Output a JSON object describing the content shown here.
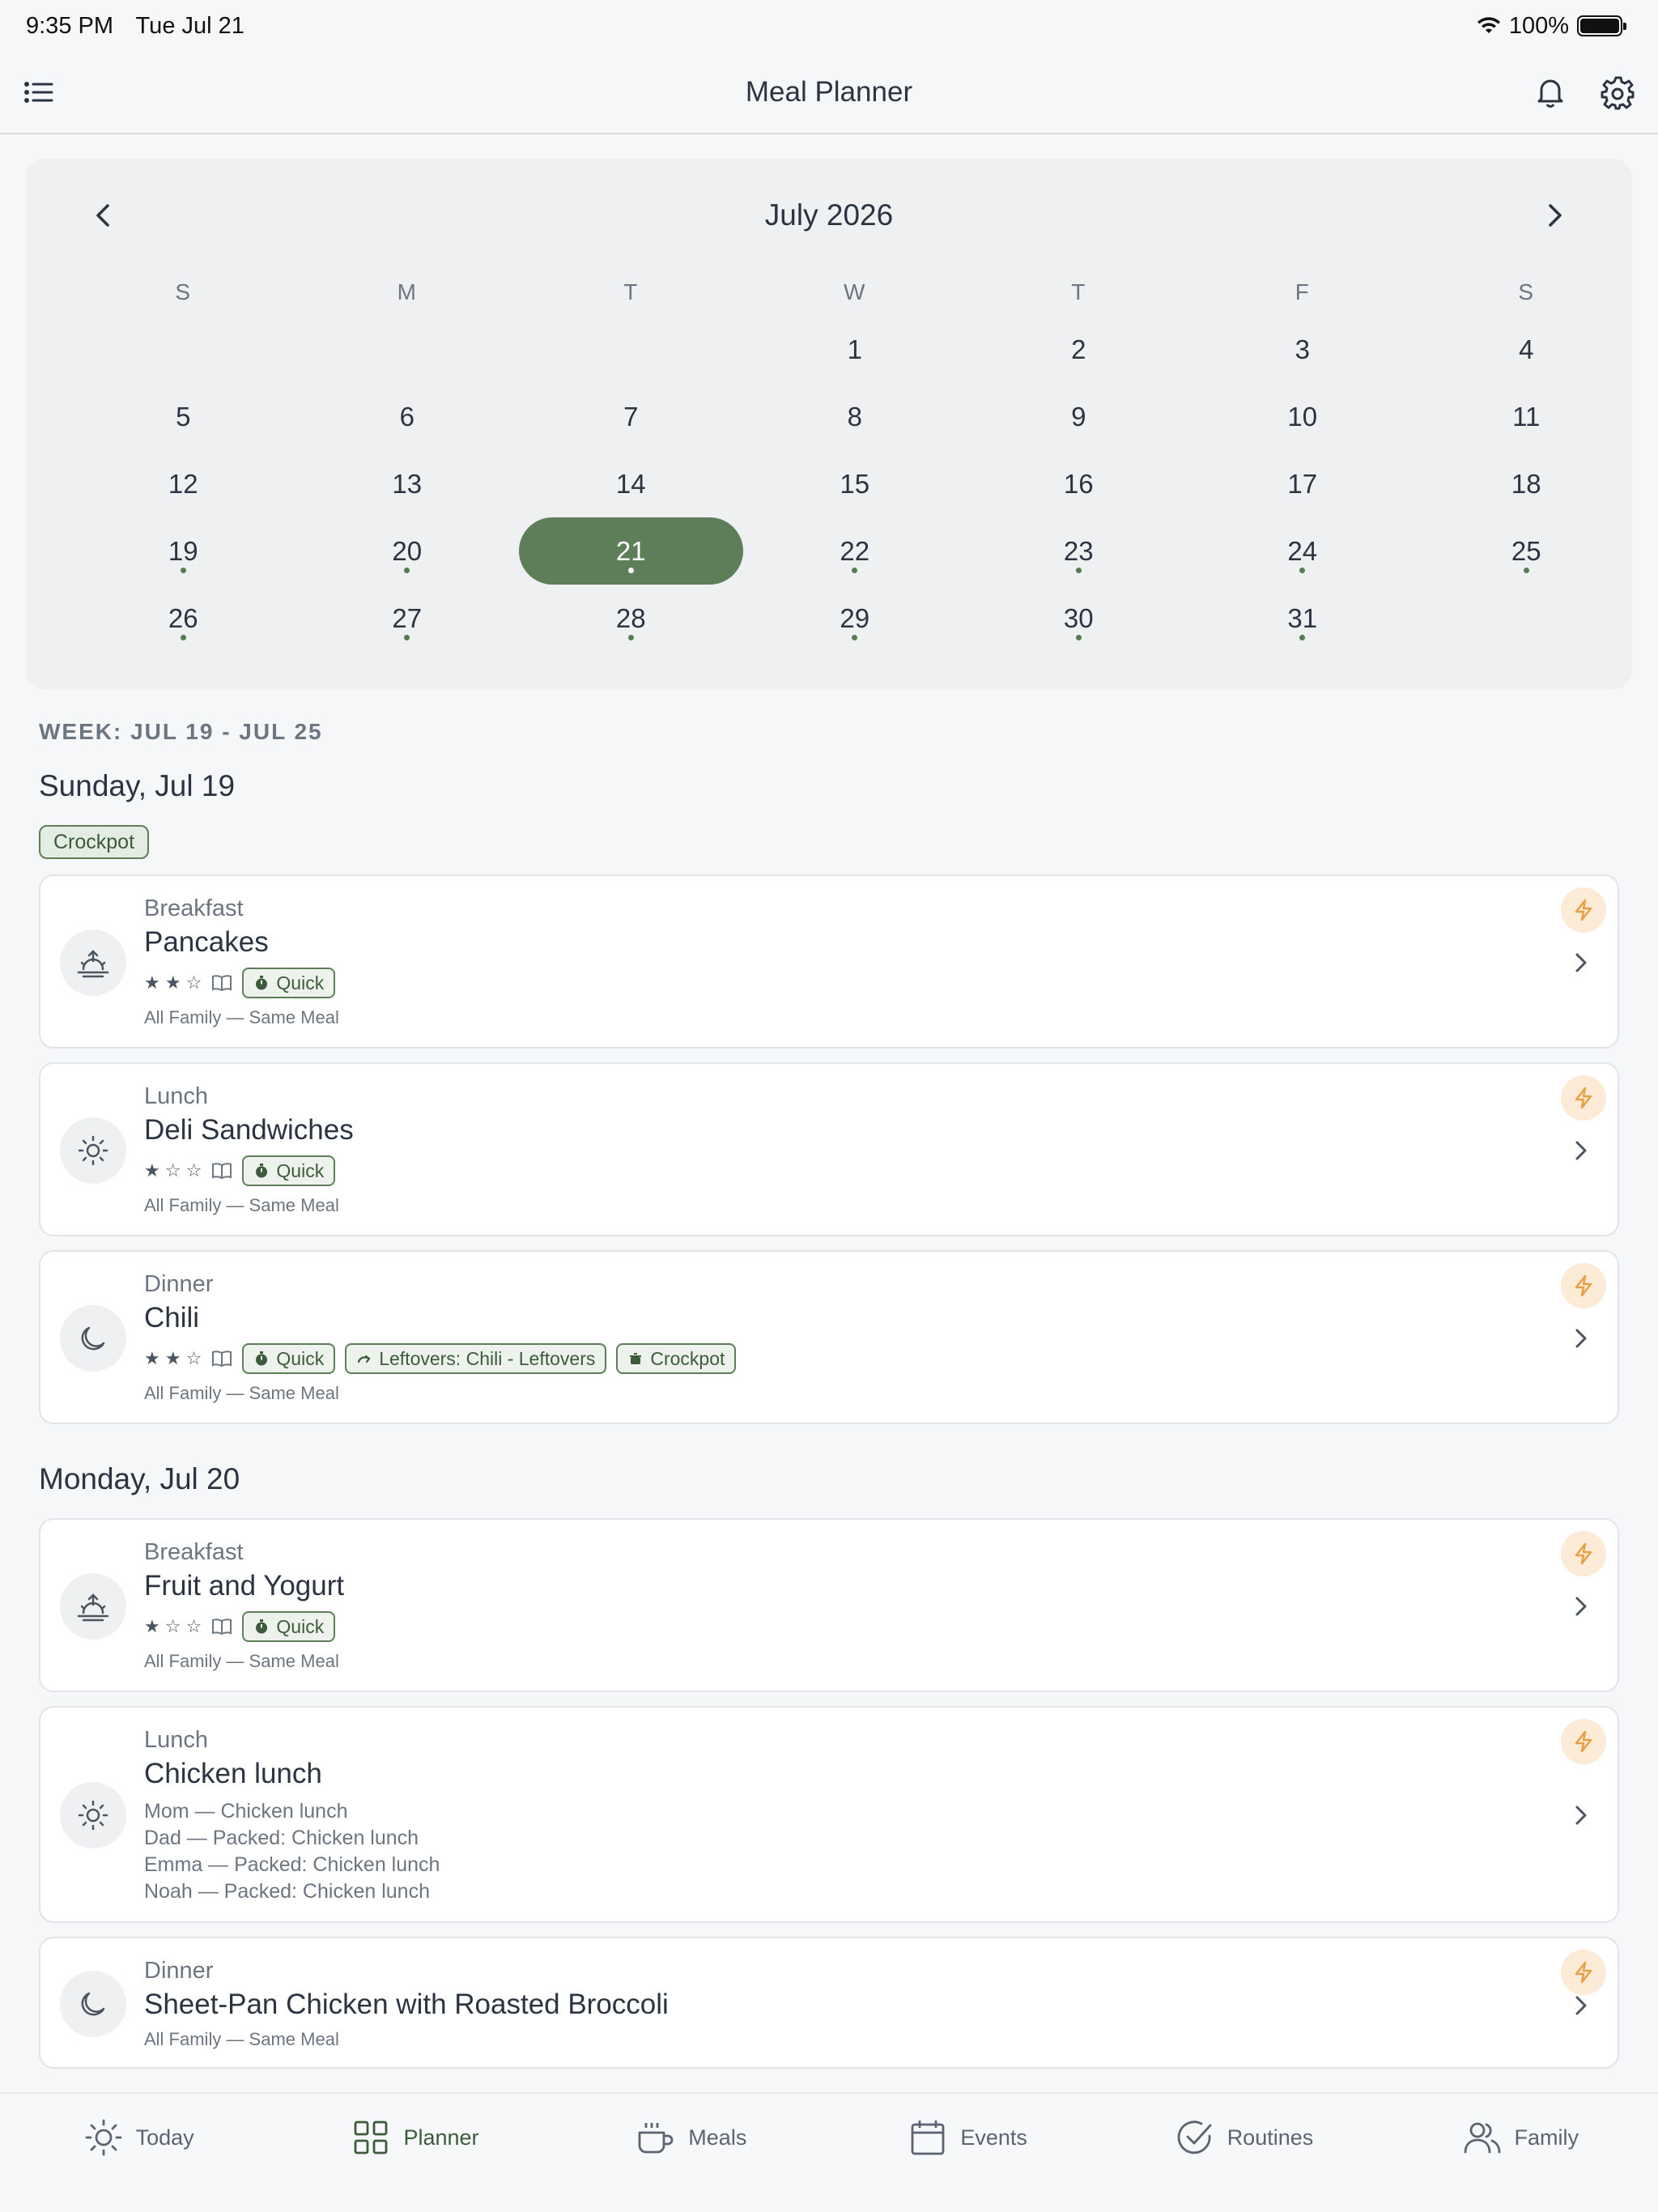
{
  "status_bar": {
    "time": "9:35 PM",
    "date": "Tue Jul 21",
    "battery": "100%"
  },
  "header": {
    "title": "Meal Planner"
  },
  "calendar": {
    "month_label": "July 2026",
    "weekdays": [
      "S",
      "M",
      "T",
      "W",
      "T",
      "F",
      "S"
    ],
    "weeks": [
      [
        "",
        "",
        "",
        "1",
        "2",
        "3",
        "4"
      ],
      [
        "5",
        "6",
        "7",
        "8",
        "9",
        "10",
        "11"
      ],
      [
        "12",
        "13",
        "14",
        "15",
        "16",
        "17",
        "18"
      ],
      [
        "19",
        "20",
        "21",
        "22",
        "23",
        "24",
        "25"
      ],
      [
        "26",
        "27",
        "28",
        "29",
        "30",
        "31",
        ""
      ]
    ],
    "selected_day": "21",
    "days_with_meals": [
      "19",
      "20",
      "21",
      "22",
      "23",
      "24",
      "25",
      "26",
      "27",
      "28",
      "29",
      "30",
      "31"
    ]
  },
  "week_label": "WEEK: JUL 19 - JUL 25",
  "days": [
    {
      "heading": "Sunday, Jul 19",
      "tag": "Crockpot",
      "meals": [
        {
          "type": "Breakfast",
          "name": "Pancakes",
          "rating_text": "★ ★ ☆",
          "badges": [
            "Quick"
          ],
          "note": "All Family — Same Meal"
        },
        {
          "type": "Lunch",
          "name": "Deli Sandwiches",
          "rating_text": "★ ☆ ☆",
          "badges": [
            "Quick"
          ],
          "note": "All Family — Same Meal"
        },
        {
          "type": "Dinner",
          "name": "Chili",
          "rating_text": "★ ★ ☆",
          "badges": [
            "Quick",
            "Leftovers: Chili - Leftovers",
            "Crockpot"
          ],
          "note": "All Family — Same Meal"
        }
      ]
    },
    {
      "heading": "Monday, Jul 20",
      "meals": [
        {
          "type": "Breakfast",
          "name": "Fruit and Yogurt",
          "rating_text": "★ ☆ ☆",
          "badges": [
            "Quick"
          ],
          "note": "All Family — Same Meal"
        },
        {
          "type": "Lunch",
          "name": "Chicken lunch",
          "people": [
            "Mom — Chicken lunch",
            "Dad — Packed: Chicken lunch",
            "Emma — Packed: Chicken lunch",
            "Noah — Packed: Chicken lunch"
          ]
        },
        {
          "type": "Dinner",
          "name": "Sheet-Pan Chicken with Roasted Broccoli",
          "note": "All Family — Same Meal"
        }
      ]
    }
  ],
  "tabs": [
    {
      "label": "Today",
      "icon": "sun-icon"
    },
    {
      "label": "Planner",
      "icon": "grid-icon",
      "active": true
    },
    {
      "label": "Meals",
      "icon": "cup-icon"
    },
    {
      "label": "Events",
      "icon": "calendar-icon"
    },
    {
      "label": "Routines",
      "icon": "check-circle-icon"
    },
    {
      "label": "Family",
      "icon": "people-icon"
    }
  ],
  "colors": {
    "accent": "#5E7E5A",
    "bolt": "#E8A045",
    "background": "#F5F7F9"
  }
}
